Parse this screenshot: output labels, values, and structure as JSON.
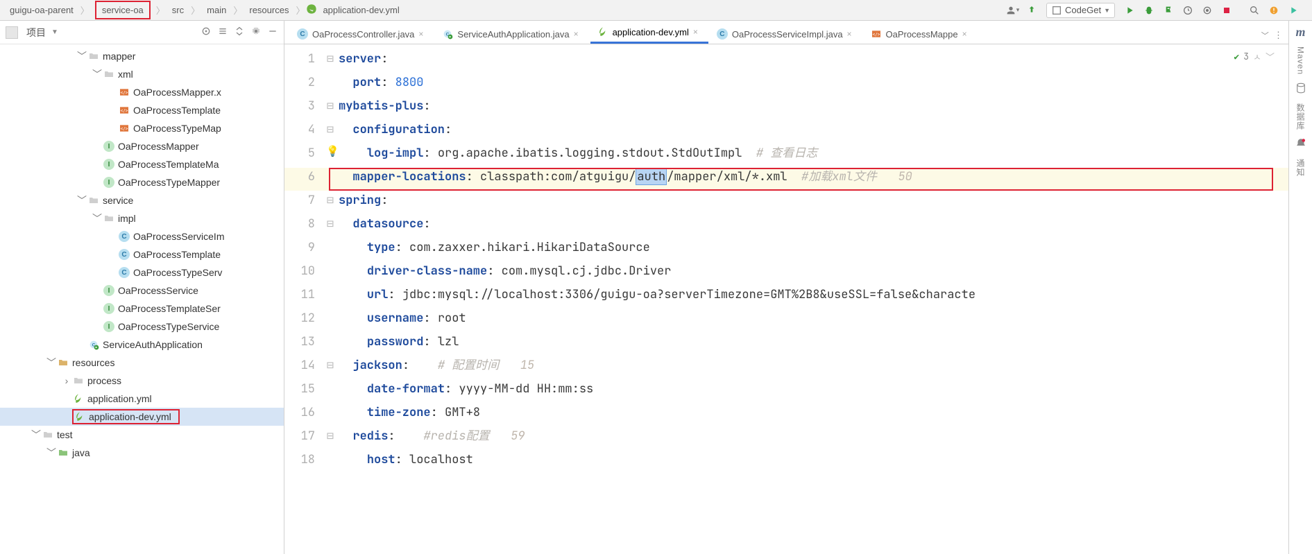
{
  "breadcrumb": {
    "root": "guigu-oa-parent",
    "module": "service-oa",
    "src": "src",
    "main": "main",
    "resources": "resources",
    "file": "application-dev.yml"
  },
  "runconfig": {
    "label": "CodeGet"
  },
  "project_panel": {
    "title": "项目"
  },
  "tree": [
    {
      "d": 5,
      "caret": "v",
      "icon": "folder-muted",
      "label": "mapper"
    },
    {
      "d": 6,
      "caret": "v",
      "icon": "folder-muted",
      "label": "xml"
    },
    {
      "d": 7,
      "caret": "",
      "icon": "xml",
      "label": "OaProcessMapper.x"
    },
    {
      "d": 7,
      "caret": "",
      "icon": "xml",
      "label": "OaProcessTemplate"
    },
    {
      "d": 7,
      "caret": "",
      "icon": "xml",
      "label": "OaProcessTypeMap"
    },
    {
      "d": 6,
      "caret": "",
      "icon": "iface",
      "label": "OaProcessMapper"
    },
    {
      "d": 6,
      "caret": "",
      "icon": "iface",
      "label": "OaProcessTemplateMa"
    },
    {
      "d": 6,
      "caret": "",
      "icon": "iface",
      "label": "OaProcessTypeMapper"
    },
    {
      "d": 5,
      "caret": "v",
      "icon": "folder-muted",
      "label": "service"
    },
    {
      "d": 6,
      "caret": "v",
      "icon": "folder-muted",
      "label": "impl"
    },
    {
      "d": 7,
      "caret": "",
      "icon": "class",
      "label": "OaProcessServiceIm"
    },
    {
      "d": 7,
      "caret": "",
      "icon": "class",
      "label": "OaProcessTemplate"
    },
    {
      "d": 7,
      "caret": "",
      "icon": "class",
      "label": "OaProcessTypeServ"
    },
    {
      "d": 6,
      "caret": "",
      "icon": "iface",
      "label": "OaProcessService"
    },
    {
      "d": 6,
      "caret": "",
      "icon": "iface",
      "label": "OaProcessTemplateSer"
    },
    {
      "d": 6,
      "caret": "",
      "icon": "iface",
      "label": "OaProcessTypeService"
    },
    {
      "d": 5,
      "caret": "",
      "icon": "spring-run",
      "label": "ServiceAuthApplication"
    },
    {
      "d": 3,
      "caret": "v",
      "icon": "folder-res",
      "label": "resources"
    },
    {
      "d": 4,
      "caret": ">",
      "icon": "folder-muted",
      "label": "process"
    },
    {
      "d": 4,
      "caret": "",
      "icon": "leaf",
      "label": "application.yml"
    },
    {
      "d": 4,
      "caret": "",
      "icon": "leaf",
      "label": "application-dev.yml",
      "selected": true
    },
    {
      "d": 2,
      "caret": "v",
      "icon": "folder-muted",
      "label": "test"
    },
    {
      "d": 3,
      "caret": "v",
      "icon": "folder-green",
      "label": "java"
    }
  ],
  "tabs": [
    {
      "icon": "class",
      "label": "OaProcessController.java",
      "active": false
    },
    {
      "icon": "spring-run",
      "label": "ServiceAuthApplication.java",
      "active": false
    },
    {
      "icon": "leaf",
      "label": "application-dev.yml",
      "active": true
    },
    {
      "icon": "class",
      "label": "OaProcessServiceImpl.java",
      "active": false
    },
    {
      "icon": "xml",
      "label": "OaProcessMappe",
      "active": false
    }
  ],
  "warn_count": "3",
  "code": {
    "l1": {
      "k": "server",
      "c": ":"
    },
    "l2": {
      "k": "port",
      "c": ": ",
      "v": "8800"
    },
    "l3": {
      "k": "mybatis-plus",
      "c": ":"
    },
    "l4": {
      "k": "configuration",
      "c": ":"
    },
    "l5": {
      "k": "log-impl",
      "c": ": ",
      "v": "org.apache.ibatis.logging.stdout.StdOutImpl",
      "cm": "  # 查看日志"
    },
    "l6": {
      "k": "mapper-locations",
      "c": ": ",
      "pre": "classpath:com/atguigu/",
      "sel": "auth",
      "post": "/mapper/xml/*.xml",
      "cm": "  #加载xml文件",
      "hint": "   50"
    },
    "l7": {
      "k": "spring",
      "c": ":"
    },
    "l8": {
      "k": "datasource",
      "c": ":"
    },
    "l9": {
      "k": "type",
      "c": ": ",
      "v": "com.zaxxer.hikari.HikariDataSource"
    },
    "l10": {
      "k": "driver-class-name",
      "c": ": ",
      "v": "com.mysql.cj.jdbc.Driver"
    },
    "l11": {
      "k": "url",
      "c": ": ",
      "v": "jdbc:mysql://localhost:3306/guigu-oa?serverTimezone=GMT%2B8&useSSL=false&characte"
    },
    "l12": {
      "k": "username",
      "c": ": ",
      "v": "root"
    },
    "l13": {
      "k": "password",
      "c": ": ",
      "v": "lzl"
    },
    "l14": {
      "k": "jackson",
      "c": ":",
      "cm": "    # 配置时间",
      "hint": "   15"
    },
    "l15": {
      "k": "date-format",
      "c": ": ",
      "v": "yyyy-MM-dd HH:mm:ss"
    },
    "l16": {
      "k": "time-zone",
      "c": ": ",
      "v": "GMT+8"
    },
    "l17": {
      "k": "redis",
      "c": ":",
      "cm": "    #redis配置",
      "hint": "   59"
    },
    "l18": {
      "k": "host",
      "c": ": ",
      "v": "localhost"
    }
  },
  "right_rail": {
    "maven": "Maven",
    "db": "数据库",
    "notify": "通知"
  }
}
